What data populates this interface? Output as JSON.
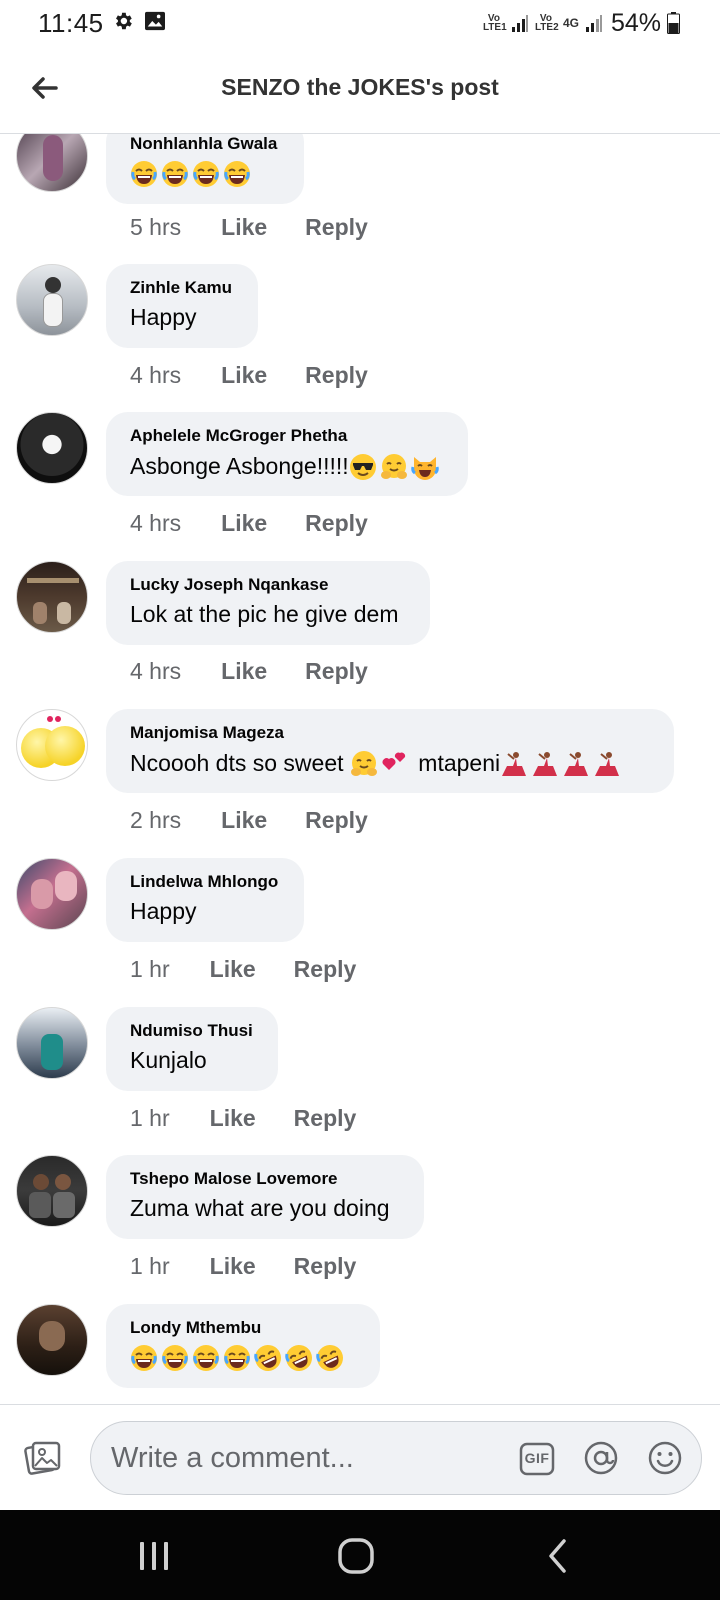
{
  "status_bar": {
    "time": "11:45",
    "sim1_tag": "Vo LTE1",
    "sim2_tag": "Vo LTE2",
    "network": "4G",
    "battery": "54%"
  },
  "header": {
    "title": "SENZO the JOKES's post",
    "back_icon": "arrow-left-icon"
  },
  "comments": [
    {
      "name": "Nonhlanhla Gwala",
      "text": "",
      "emojis": [
        "joy",
        "joy",
        "joy",
        "joy"
      ],
      "time": "5 hrs",
      "like": "Like",
      "reply": "Reply"
    },
    {
      "name": "Zinhle Kamu",
      "text": "Happy",
      "emojis": [],
      "time": "4 hrs",
      "like": "Like",
      "reply": "Reply"
    },
    {
      "name": "Aphelele McGroger Phetha",
      "text": "Asbonge Asbonge!!!!!",
      "emojis": [
        "sunglasses",
        "hug",
        "cat-joy"
      ],
      "time": "4 hrs",
      "like": "Like",
      "reply": "Reply"
    },
    {
      "name": "Lucky Joseph Nqankase",
      "text": "Lok at the pic he give dem",
      "emojis": [],
      "time": "4 hrs",
      "like": "Like",
      "reply": "Reply"
    },
    {
      "name": "Manjomisa Mageza",
      "text": "Ncoooh dts so sweet ",
      "text2": " mtapeni",
      "emojis": [
        "hug",
        "hearts"
      ],
      "emojis2": [
        "dancer",
        "dancer",
        "dancer",
        "dancer"
      ],
      "time": "2 hrs",
      "like": "Like",
      "reply": "Reply"
    },
    {
      "name": "Lindelwa Mhlongo",
      "text": "Happy",
      "emojis": [],
      "time": "1 hr",
      "like": "Like",
      "reply": "Reply"
    },
    {
      "name": "Ndumiso Thusi",
      "text": "Kunjalo",
      "emojis": [],
      "time": "1 hr",
      "like": "Like",
      "reply": "Reply"
    },
    {
      "name": "Tshepo Malose Lovemore",
      "text": "Zuma what are you doing",
      "emojis": [],
      "time": "1 hr",
      "like": "Like",
      "reply": "Reply"
    },
    {
      "name": "Londy Mthembu",
      "text": "",
      "emojis": [
        "joy",
        "joy",
        "joy",
        "joy",
        "rofl",
        "rofl",
        "rofl"
      ],
      "time": "",
      "like": "",
      "reply": ""
    }
  ],
  "composer": {
    "placeholder": "Write a comment...",
    "gif_label": "GIF"
  },
  "colors": {
    "bubble": "#f0f2f5",
    "meta_text": "#65676b",
    "nav_bar": "#050505"
  }
}
